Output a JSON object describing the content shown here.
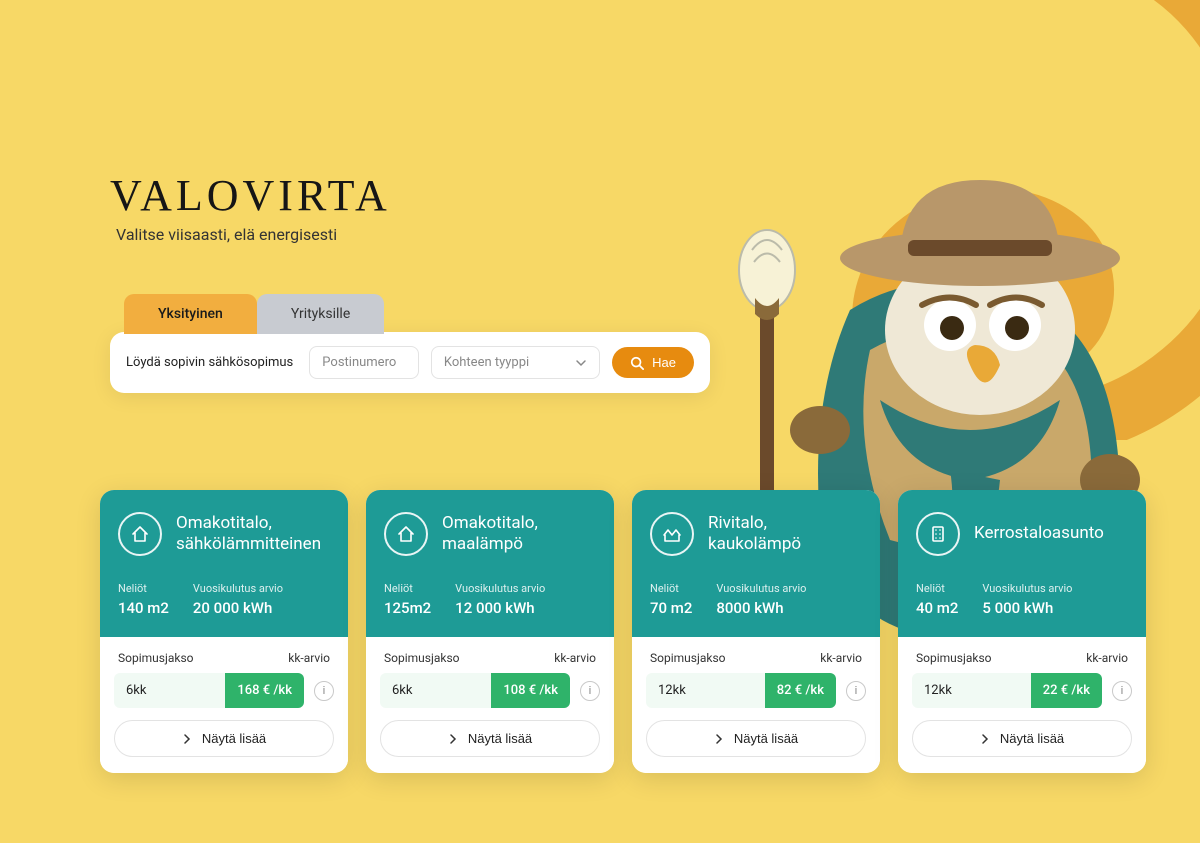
{
  "brand": {
    "name": "VALOVIRTA",
    "tagline": "Valitse viisaasti, elä energisesti"
  },
  "tabs": {
    "active": "Yksityinen",
    "inactive": "Yrityksille"
  },
  "search": {
    "label": "Löydä sopivin sähkösopimus",
    "postal_placeholder": "Postinumero",
    "type_placeholder": "Kohteen tyyppi",
    "button": "Hae"
  },
  "field_labels": {
    "area": "Neliöt",
    "consumption": "Vuosikulutus arvio",
    "period": "Sopimusjakso",
    "monthly": "kk-arvio",
    "show_more": "Näytä lisää"
  },
  "cards": [
    {
      "icon": "house",
      "title": "Omakotitalo, sähkölämmitteinen",
      "area": "140 m2",
      "consumption": "20 000 kWh",
      "period": "6kk",
      "price": "168 € /kk"
    },
    {
      "icon": "house",
      "title": "Omakotitalo, maalämpö",
      "area": "125m2",
      "consumption": "12 000 kWh",
      "period": "6kk",
      "price": "108 € /kk"
    },
    {
      "icon": "rowhouse",
      "title": "Rivitalo, kaukolämpö",
      "area": "70 m2",
      "consumption": "8000 kWh",
      "period": "12kk",
      "price": "82 € /kk"
    },
    {
      "icon": "apartment",
      "title": "Kerrostaloasunto",
      "area": "40 m2",
      "consumption": "5 000 kWh",
      "period": "12kk",
      "price": "22 € /kk"
    }
  ]
}
